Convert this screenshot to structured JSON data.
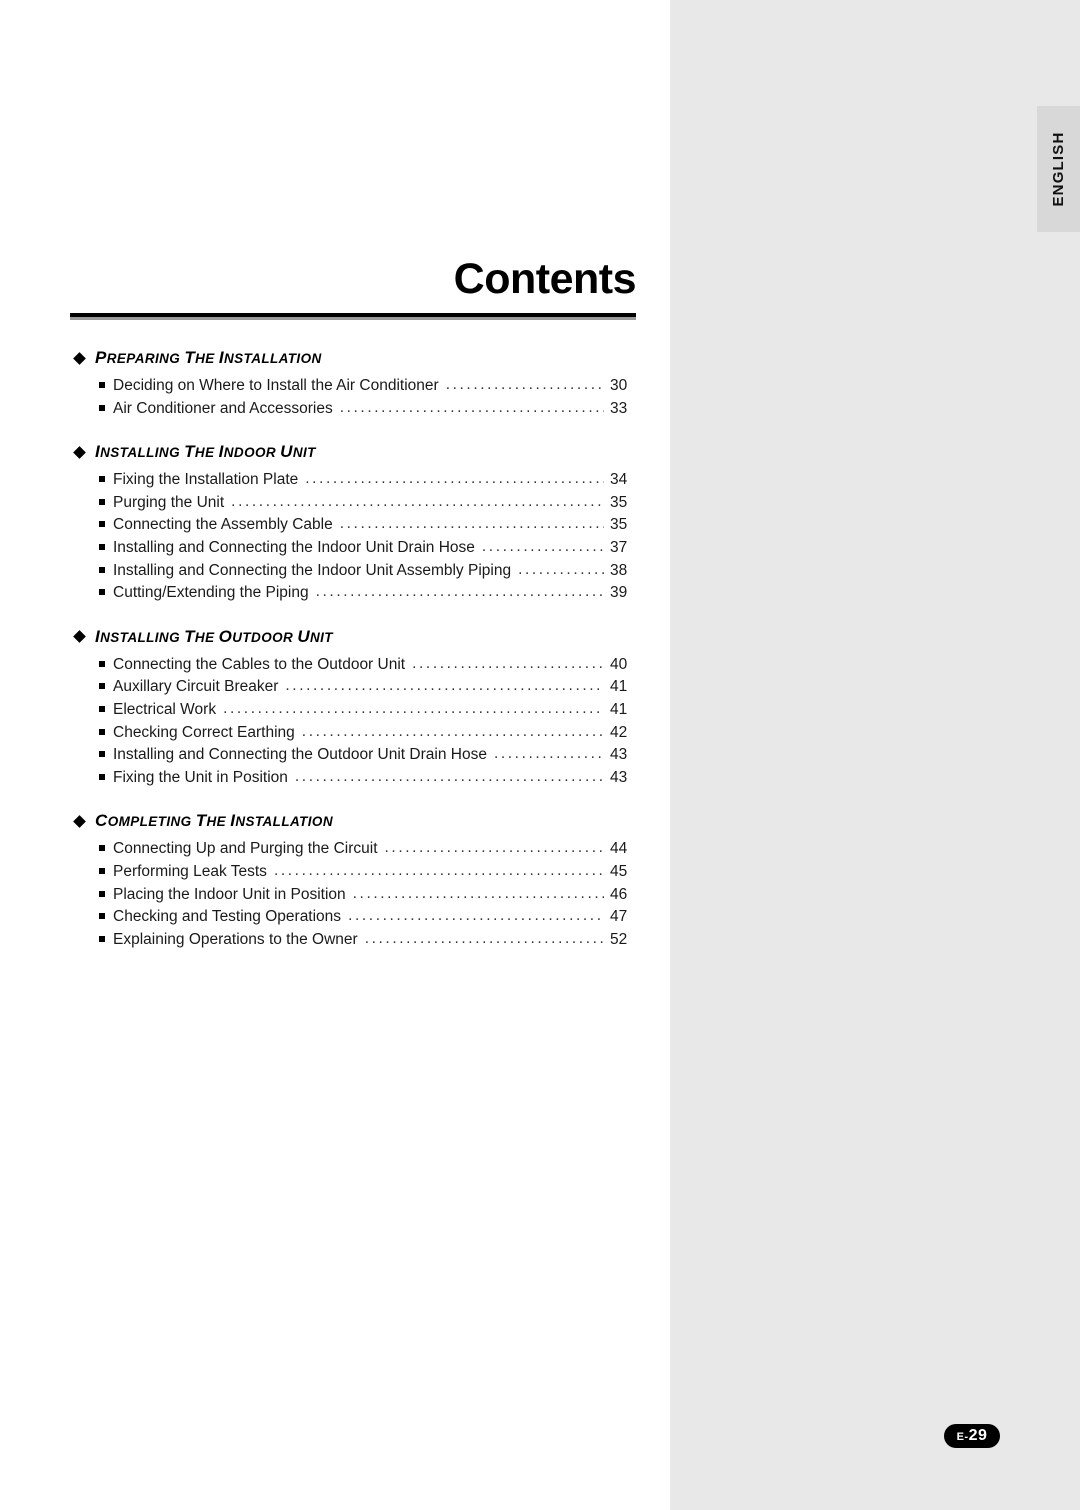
{
  "language_tab": {
    "label": "ENGLISH"
  },
  "page_title": "Contents",
  "folio": {
    "prefix": "E-",
    "number": "29"
  },
  "sections": [
    {
      "title": "PREPARING THE INSTALLATION",
      "entries": [
        {
          "label": "Deciding on Where to Install the Air Conditioner",
          "page": "30"
        },
        {
          "label": "Air Conditioner and Accessories",
          "page": "33"
        }
      ]
    },
    {
      "title": "INSTALLING THE INDOOR UNIT",
      "entries": [
        {
          "label": "Fixing the Installation Plate",
          "page": "34"
        },
        {
          "label": "Purging the Unit",
          "page": "35"
        },
        {
          "label": "Connecting the Assembly Cable",
          "page": "35"
        },
        {
          "label": "Installing and Connecting the Indoor Unit Drain Hose",
          "page": "37"
        },
        {
          "label": "Installing and Connecting the Indoor Unit Assembly Piping",
          "page": "38"
        },
        {
          "label": "Cutting/Extending the Piping",
          "page": "39"
        }
      ]
    },
    {
      "title": "INSTALLING THE OUTDOOR UNIT",
      "entries": [
        {
          "label": "Connecting the Cables to the Outdoor Unit",
          "page": "40"
        },
        {
          "label": "Auxillary Circuit Breaker",
          "page": "41"
        },
        {
          "label": "Electrical Work",
          "page": "41"
        },
        {
          "label": "Checking Correct Earthing",
          "page": "42"
        },
        {
          "label": "Installing and Connecting the Outdoor Unit Drain Hose",
          "page": "43"
        },
        {
          "label": "Fixing the Unit in Position",
          "page": "43"
        }
      ]
    },
    {
      "title": "COMPLETING THE INSTALLATION",
      "entries": [
        {
          "label": "Connecting Up and Purging the Circuit",
          "page": "44"
        },
        {
          "label": "Performing Leak Tests",
          "page": "45"
        },
        {
          "label": "Placing the Indoor Unit in Position",
          "page": "46"
        },
        {
          "label": "Checking and Testing Operations",
          "page": "47"
        },
        {
          "label": "Explaining Operations to the Owner",
          "page": "52"
        }
      ]
    }
  ]
}
